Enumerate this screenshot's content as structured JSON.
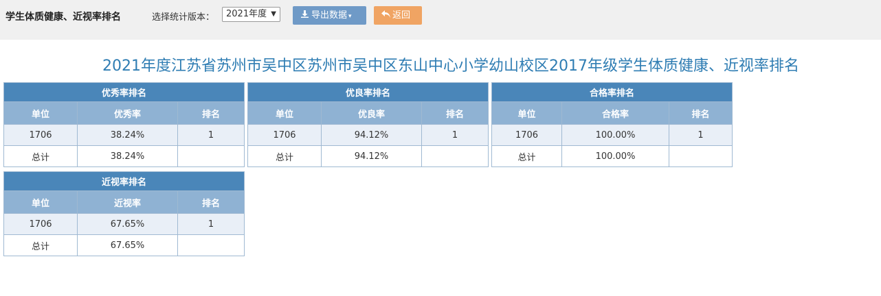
{
  "topbar": {
    "title": "学生体质健康、近视率排名",
    "version_label": "选择统计版本：",
    "version_selected": "2021年度",
    "export_label": "导出数据",
    "back_label": "返回"
  },
  "heading": "2021年度江苏省苏州市吴中区苏州市吴中区东山中心小学幼山校区2017年级学生体质健康、近视率排名",
  "tables": [
    {
      "caption": "优秀率排名",
      "headers": [
        "单位",
        "优秀率",
        "排名"
      ],
      "rows": [
        [
          "1706",
          "38.24%",
          "1"
        ],
        [
          "总计",
          "38.24%",
          ""
        ]
      ]
    },
    {
      "caption": "优良率排名",
      "headers": [
        "单位",
        "优良率",
        "排名"
      ],
      "rows": [
        [
          "1706",
          "94.12%",
          "1"
        ],
        [
          "总计",
          "94.12%",
          ""
        ]
      ]
    },
    {
      "caption": "合格率排名",
      "headers": [
        "单位",
        "合格率",
        "排名"
      ],
      "rows": [
        [
          "1706",
          "100.00%",
          "1"
        ],
        [
          "总计",
          "100.00%",
          ""
        ]
      ]
    },
    {
      "caption": "近视率排名",
      "headers": [
        "单位",
        "近视率",
        "排名"
      ],
      "rows": [
        [
          "1706",
          "67.65%",
          "1"
        ],
        [
          "总计",
          "67.65%",
          ""
        ]
      ]
    }
  ]
}
